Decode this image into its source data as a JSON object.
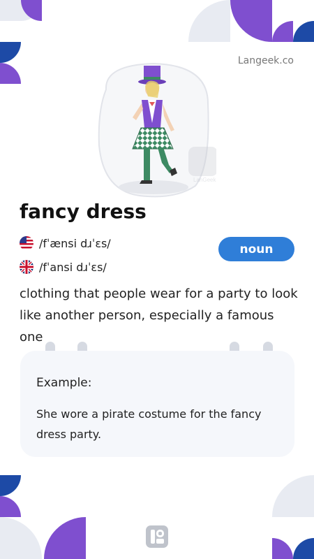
{
  "app": {
    "brand": "Langeek.co",
    "watermark": "LanGeek"
  },
  "entry": {
    "word": "fancy dress",
    "pronunciations": [
      {
        "accent": "US",
        "flag_icon": "us-flag-icon",
        "ipa": "/fˈænsi dɹˈɛs/"
      },
      {
        "accent": "UK",
        "flag_icon": "uk-flag-icon",
        "ipa": "/fˈansi dɹˈɛs/"
      }
    ],
    "part_of_speech": "noun",
    "definition": "clothing that people wear for a party to look like another person, especially a famous one"
  },
  "example": {
    "label": "Example:",
    "sentence": "She wore a pirate costume for the fancy dress party."
  },
  "colors": {
    "accent": "#2f7ed8",
    "purple": "#7f4fcf",
    "navy": "#1d4aa6",
    "light": "#e8ebf2",
    "card": "#f5f7fb"
  }
}
